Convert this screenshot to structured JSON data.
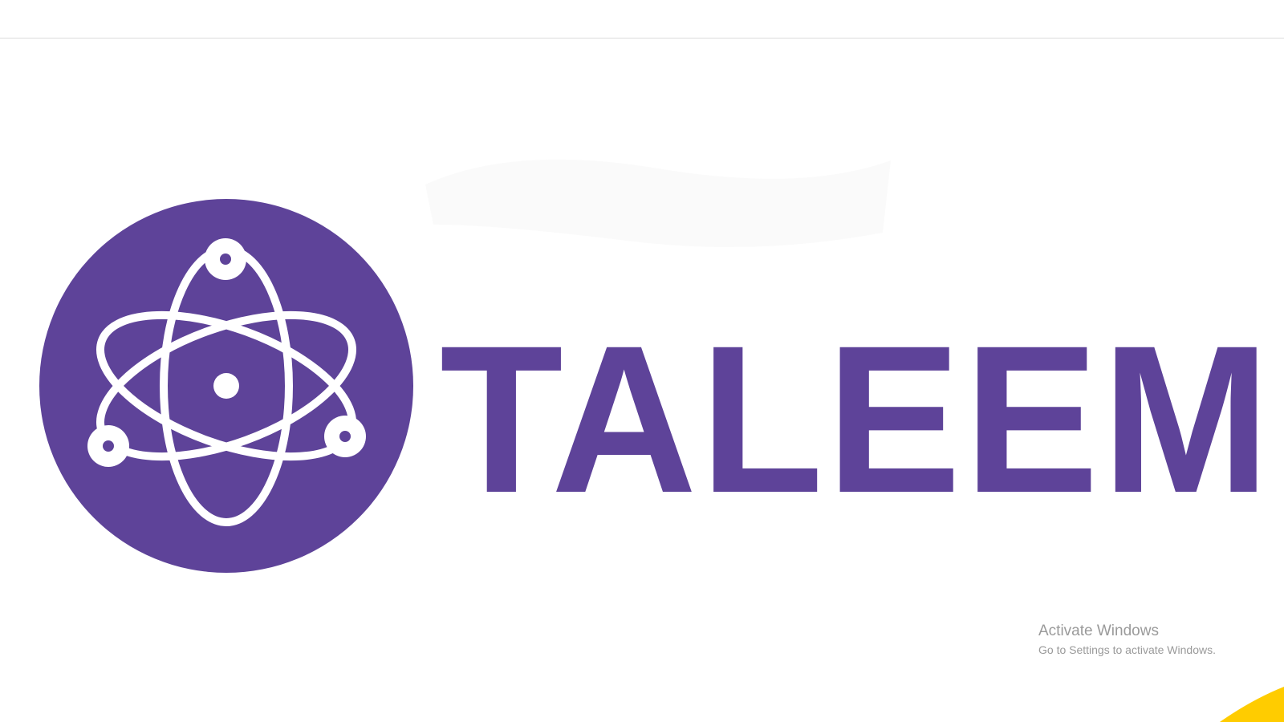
{
  "brand": {
    "name": "TALEEM",
    "primary_color": "#5e4399",
    "emblem_icon": "atom-icon",
    "emblem_line_color": "#ffffff"
  },
  "system_notice": {
    "title": "Activate Windows",
    "subtitle": "Go to Settings to activate Windows."
  },
  "accent": {
    "corner_color": "#ffcc00"
  }
}
